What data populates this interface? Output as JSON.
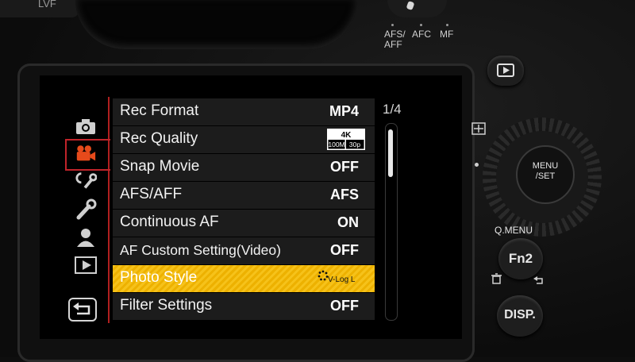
{
  "camera": {
    "lvf_label": "LVF",
    "focus_mode_labels": [
      "AFS/\nAFF",
      "AFC",
      "MF"
    ],
    "qmenu_label": "Q.MENU",
    "fn2_label": "Fn2",
    "menu_set_label": "MENU\n/SET",
    "disp_label": "DISP."
  },
  "menu": {
    "page": "1/4",
    "categories": [
      {
        "name": "camera-icon",
        "active": false
      },
      {
        "name": "movie-camera-icon",
        "active": true
      },
      {
        "name": "custom-wrench-c-icon",
        "active": false
      },
      {
        "name": "setup-wrench-icon",
        "active": false
      },
      {
        "name": "person-icon",
        "active": false
      },
      {
        "name": "playback-icon",
        "active": false
      }
    ],
    "back_icon": "return-arrow-icon",
    "rows": [
      {
        "label": "Rec Format",
        "value": "MP4",
        "selected": false
      },
      {
        "label": "Rec Quality",
        "value": "",
        "selected": false
      },
      {
        "label": "Snap Movie",
        "value": "OFF",
        "selected": false
      },
      {
        "label": "AFS/AFF",
        "value": "AFS",
        "selected": false
      },
      {
        "label": "Continuous AF",
        "value": "ON",
        "selected": false
      },
      {
        "label": "AF Custom Setting(Video)",
        "value": "OFF",
        "selected": false
      },
      {
        "label": "Photo Style",
        "value": "V-Log L",
        "selected": true
      },
      {
        "label": "Filter Settings",
        "value": "OFF",
        "selected": false
      }
    ],
    "rec_quality_badge": {
      "top": "4K",
      "left": "100M",
      "right": "30p"
    },
    "accent_color": "#f0b400",
    "category_accent": "#c0242a"
  }
}
